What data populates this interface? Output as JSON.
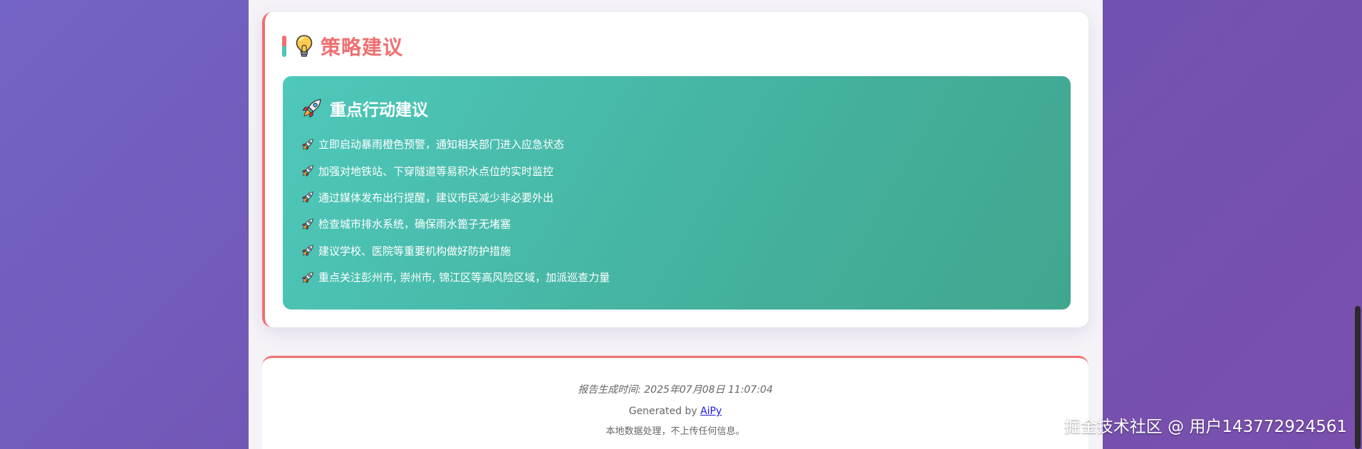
{
  "strategy": {
    "title": "策略建议",
    "bulb_icon": "lightbulb-icon",
    "action_panel": {
      "title": "重点行动建议",
      "icon": "rocket-icon",
      "items": [
        "立即启动暴雨橙色预警，通知相关部门进入应急状态",
        "加强对地铁站、下穿隧道等易积水点位的实时监控",
        "通过媒体发布出行提醒，建议市民减少非必要外出",
        "检查城市排水系统，确保雨水篦子无堵塞",
        "建议学校、医院等重要机构做好防护措施",
        "重点关注彭州市, 崇州市, 锦江区等高风险区域，加派巡查力量"
      ]
    }
  },
  "footer": {
    "generated_time": "报告生成时间: 2025年07月08日 11:07:04",
    "generated_by_prefix": "Generated by ",
    "generated_by_link": "AiPy",
    "privacy_note": "本地数据处理，不上传任何信息。"
  },
  "watermark": "掘金技术社区 @ 用户143772924561",
  "colors": {
    "accent_red": "#ef6f6f",
    "accent_teal": "#45b3a0",
    "background_purple": "#7463c6"
  }
}
